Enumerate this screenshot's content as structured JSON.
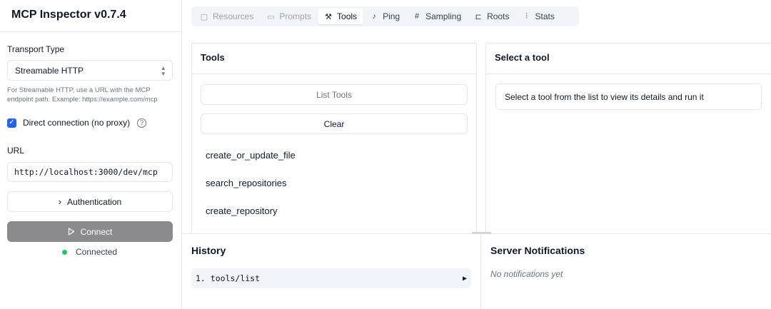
{
  "app": {
    "title": "MCP Inspector v0.7.4"
  },
  "sidebar": {
    "transport_label": "Transport Type",
    "transport_value": "Streamable HTTP",
    "transport_hint": "For Streamable HTTP, use a URL with the MCP endpoint path. Example: https://example.com/mcp",
    "direct_connection_label": "Direct connection (no proxy)",
    "direct_connection_checked": true,
    "url_label": "URL",
    "url_value": "http://localhost:3000/dev/mcp",
    "auth_label": "Authentication",
    "connect_label": "Connect",
    "status_text": "Connected",
    "status_color": "#22c55e"
  },
  "tabs": [
    {
      "label": "Resources",
      "icon": "resources-icon",
      "state": "disabled"
    },
    {
      "label": "Prompts",
      "icon": "prompts-icon",
      "state": "disabled"
    },
    {
      "label": "Tools",
      "icon": "hammer-icon",
      "state": "active"
    },
    {
      "label": "Ping",
      "icon": "bell-icon",
      "state": "normal"
    },
    {
      "label": "Sampling",
      "icon": "hash-icon",
      "state": "normal"
    },
    {
      "label": "Roots",
      "icon": "folder-tree-icon",
      "state": "normal"
    },
    {
      "label": "Stats",
      "icon": "bar-chart-icon",
      "state": "normal"
    }
  ],
  "tools_panel": {
    "title": "Tools",
    "list_button": "List Tools",
    "clear_button": "Clear",
    "items": [
      "create_or_update_file",
      "search_repositories",
      "create_repository"
    ]
  },
  "detail_panel": {
    "title": "Select a tool",
    "message": "Select a tool from the list to view its details and run it"
  },
  "history": {
    "title": "History",
    "entries": [
      {
        "index": "1.",
        "method": "tools/list"
      }
    ]
  },
  "notifications": {
    "title": "Server Notifications",
    "empty_text": "No notifications yet"
  }
}
